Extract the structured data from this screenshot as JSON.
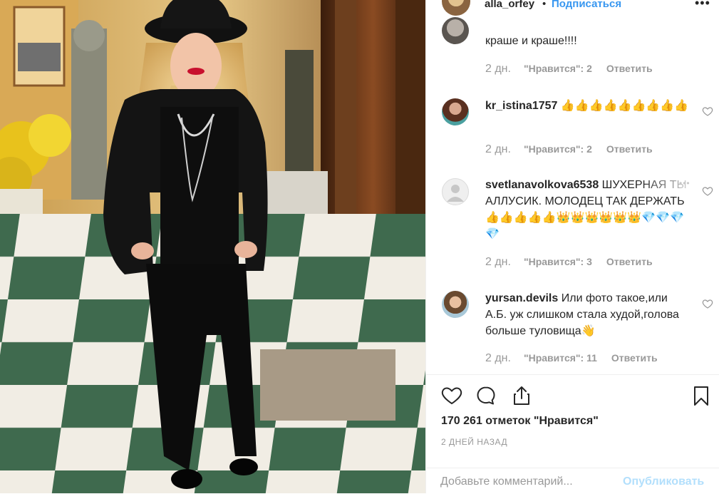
{
  "header": {
    "username": "alla_orfey",
    "separator": "•",
    "follow_label": "Подписаться",
    "more_label": "•••"
  },
  "comments": [
    {
      "text": "краше и краше!!!!",
      "time": "2 дн.",
      "likes": "\"Нравится\": 2",
      "reply": "Ответить"
    },
    {
      "username": "kr_istina1757",
      "text": "👍👍👍👍👍👍👍👍👍",
      "time": "2 дн.",
      "likes": "\"Нравится\": 2",
      "reply": "Ответить"
    },
    {
      "username": "svetlanavolkova6538",
      "text": "ШУХЕРНАЯ ТЫ АЛЛУСИК. МОЛОДЕЦ ТАК ДЕРЖАТЬ👍👍👍👍👍👑👑👑👑👑👑💎💎💎💎",
      "time": "2 дн.",
      "likes": "\"Нравится\": 3",
      "reply": "Ответить"
    },
    {
      "username": "yursan.devils",
      "text": "Или фото такое,или А.Б. уж слишком стала худой,голова больше туловища👋",
      "time": "2 дн.",
      "likes": "\"Нравится\": 11",
      "reply": "Ответить"
    }
  ],
  "actions": {
    "like_icon": "heart-icon",
    "comment_icon": "comment-bubble-icon",
    "share_icon": "share-icon",
    "save_icon": "bookmark-icon"
  },
  "likes_count": "170 261 отметок \"Нравится\"",
  "post_date": "2 ДНЕЙ НАЗАД",
  "comment_input": {
    "placeholder": "Добавьте комментарий...",
    "post_label": "Опубликовать"
  },
  "colors": {
    "link_blue": "#3897f0",
    "post_disabled": "#b2dffc",
    "meta_gray": "#999999"
  }
}
